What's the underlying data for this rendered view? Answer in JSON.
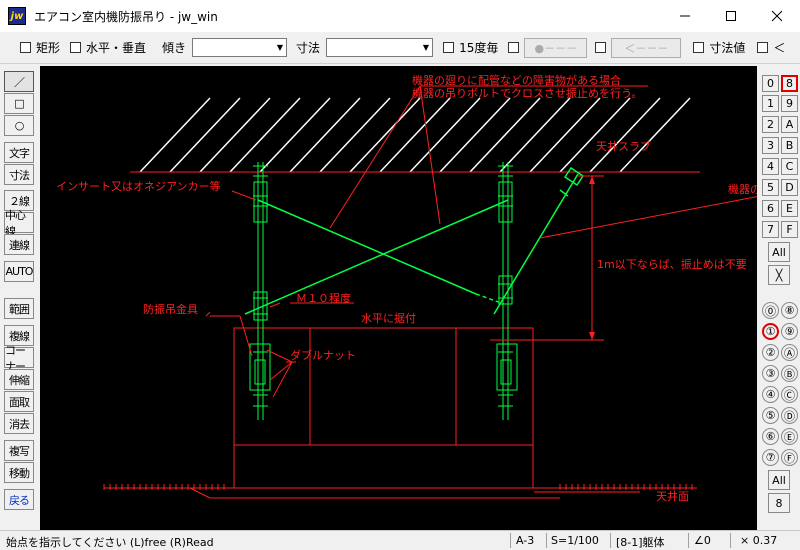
{
  "window": {
    "icon_text": "jw",
    "title": "エアコン室内機防振吊り - jw_win",
    "minimize_icon": "minimize-icon",
    "maximize_icon": "maximize-icon",
    "close_icon": "close-icon"
  },
  "toolbar": {
    "rect_label": "矩形",
    "hv_label": "水平・垂直",
    "tilt_label": "傾き",
    "tilt_value": "",
    "dim_label": "寸法",
    "dim_value": "",
    "deg15_label": "15度毎",
    "dotline_label": "●－－－",
    "arrow_label": "＜－－－",
    "dimval_label": "寸法値",
    "lt_label": "＜"
  },
  "leftbar": {
    "line": "／",
    "rect": "□",
    "circle": "○",
    "text": "文字",
    "dim": "寸法",
    "double": "２線",
    "center": "中心線",
    "continuous": "連線",
    "auto": "AUTO",
    "range": "範囲",
    "copy_line": "複線",
    "corner": "コーナー",
    "stretch": "伸縮",
    "chamfer": "面取",
    "erase": "消去",
    "copy": "複写",
    "move": "移動",
    "back": "戻る"
  },
  "rightbar": {
    "layers_left": [
      "0",
      "1",
      "2",
      "3",
      "4",
      "5",
      "6",
      "7"
    ],
    "layers_right": [
      "8",
      "9",
      "A",
      "B",
      "C",
      "D",
      "E",
      "F"
    ],
    "all_label": "All",
    "x_label": "╳",
    "groups_left": [
      "⓪",
      "①",
      "②",
      "③",
      "④",
      "⑤",
      "⑥",
      "⑦"
    ],
    "groups_right": [
      "⑧",
      "⑨",
      "Ⓐ",
      "Ⓑ",
      "Ⓒ",
      "Ⓓ",
      "Ⓔ",
      "Ⓕ"
    ],
    "all2_label": "All",
    "eight_label": "8"
  },
  "drawing": {
    "note1": "機器の廻りに配管などの障害物がある場合",
    "note2": "機器の吊りボルトでクロスさせ振止めを行う。",
    "slab": "天井スラブ",
    "insert": "インサート又はオネジアンカー等",
    "machine": "機器の",
    "span": "1m以下ならば、振止めは不要",
    "hanger": "防振吊金具",
    "m10": "Ｍ１０程度",
    "level": "水平に据付",
    "double_nut": "ダブルナット",
    "ceiling": "天井面"
  },
  "colors": {
    "annotation": "#ff2020",
    "member": "#00ff40",
    "canvas": "#000000"
  },
  "status": {
    "prompt": "始点を指示してください (L)free (R)Read",
    "paper": "A-3",
    "scale": "S=1/100",
    "layer": "[8-1]躯体",
    "angle": "∠0",
    "factor": "× 0.37"
  }
}
